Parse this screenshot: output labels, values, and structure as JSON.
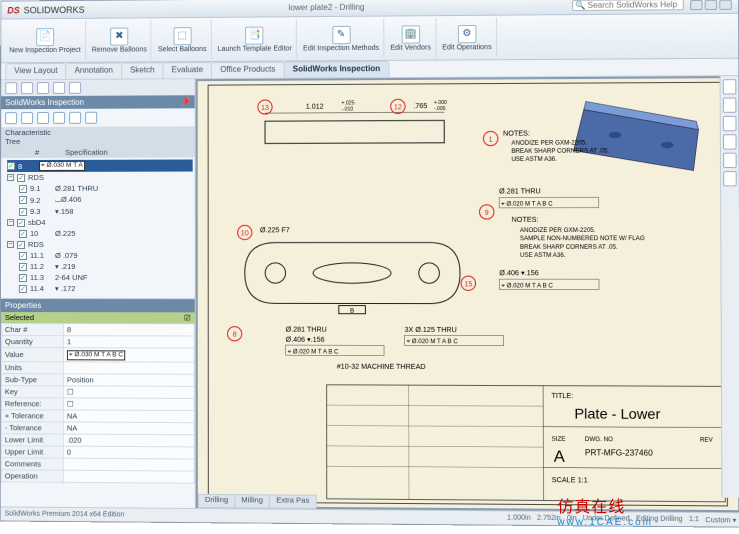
{
  "app": {
    "name": "SOLIDWORKS",
    "doc_title": "lower plate2 - Drilling",
    "search_placeholder": "Search SolidWorks Help"
  },
  "ribbon": [
    {
      "label": "New Inspection Project",
      "glyph": "📄"
    },
    {
      "label": "Remove Balloons",
      "glyph": "✖"
    },
    {
      "label": "Select Balloons",
      "glyph": "⬚"
    },
    {
      "label": "Launch Template Editor",
      "glyph": "📑"
    },
    {
      "label": "Edit Inspection Methods",
      "glyph": "✎"
    },
    {
      "label": "Edit Vendors",
      "glyph": "🏢"
    },
    {
      "label": "Edit Operations",
      "glyph": "⚙"
    }
  ],
  "tabs": [
    "View Layout",
    "Annotation",
    "Sketch",
    "Evaluate",
    "Office Products",
    "SolidWorks Inspection"
  ],
  "active_tab": "SolidWorks Inspection",
  "panel_title": "SolidWorks Inspection",
  "tree_header": {
    "col1": "#",
    "col2": "Specification"
  },
  "tree": [
    {
      "lvl": 0,
      "tog": "-",
      "chk": true,
      "num": "8",
      "spec": "⌖ Ø.030 M T A",
      "sel": true,
      "type": "gdt"
    },
    {
      "lvl": 0,
      "tog": "-",
      "chk": true,
      "num": "",
      "spec": "RDS",
      "type": "grp"
    },
    {
      "lvl": 1,
      "chk": true,
      "num": "9.1",
      "spec": "Ø.281 THRU"
    },
    {
      "lvl": 1,
      "chk": true,
      "num": "9.2",
      "spec": "⌴Ø.406"
    },
    {
      "lvl": 1,
      "chk": true,
      "num": "9.3",
      "spec": "▾.158"
    },
    {
      "lvl": 0,
      "tog": "-",
      "chk": true,
      "num": "",
      "spec": "sbD4",
      "type": "grp"
    },
    {
      "lvl": 1,
      "chk": true,
      "num": "10",
      "spec": "Ø.225"
    },
    {
      "lvl": 0,
      "tog": "-",
      "chk": true,
      "num": "",
      "spec": "RDS",
      "type": "grp"
    },
    {
      "lvl": 1,
      "chk": true,
      "num": "11.1",
      "spec": "Ø .079"
    },
    {
      "lvl": 1,
      "chk": true,
      "num": "11.2",
      "spec": "▾ .219"
    },
    {
      "lvl": 1,
      "chk": true,
      "num": "11.3",
      "spec": "2-64 UNF"
    },
    {
      "lvl": 1,
      "chk": true,
      "num": "11.4",
      "spec": "▾ .172"
    }
  ],
  "props": {
    "title": "Properties",
    "selected_label": "Selected",
    "rows": [
      {
        "k": "Char #",
        "v": "8"
      },
      {
        "k": "Quantity",
        "v": "1"
      },
      {
        "k": "Value",
        "v": "⌖ Ø.030 M T A B C"
      },
      {
        "k": "Units",
        "v": ""
      },
      {
        "k": "Sub-Type",
        "v": "Position"
      },
      {
        "k": "Key",
        "v": "☐"
      },
      {
        "k": "Reference:",
        "v": "☐"
      },
      {
        "k": "+ Tolerance",
        "v": "NA"
      },
      {
        "k": "- Tolerance",
        "v": "NA"
      },
      {
        "k": "Lower Limit",
        "v": ".020"
      },
      {
        "k": "Upper Limit",
        "v": "0"
      },
      {
        "k": "Comments",
        "v": ""
      },
      {
        "k": "Operation",
        "v": ""
      }
    ]
  },
  "drawing": {
    "dim_top_left": "1.012",
    "tol_top_left_u": "+.025",
    "tol_top_left_l": "-.010",
    "dim_top_right": ".765",
    "tol_top_right_u": "+.000",
    "tol_top_right_l": "-.005",
    "notes_title": "NOTES:",
    "notes": [
      "ANODIZE PER GXM-2205.",
      "BREAK SHARP CORNERS AT .05.",
      "USE ASTM A36."
    ],
    "notes2": [
      "ANODIZE PER GXM-2205.",
      "SAMPLE NON-NUMBERED NOTE W/ FLAG",
      "BREAK SHARP CORNERS AT .05.",
      "USE ASTM A36."
    ],
    "balloons": {
      "b1": "1",
      "b9": "9",
      "b10": "10",
      "b12": "12",
      "b13": "13",
      "b15": "15"
    },
    "dim_225": "Ø.225 F7",
    "dim_281": "Ø.281 THRU",
    "gdt_281": "⌖ Ø.020 M T A B C",
    "dim_406": "Ø.406 ▾.156",
    "gdt_406": "⌖ Ø.020 M T A B C",
    "dim_281b": "Ø.281 THRU",
    "dim_406b": "Ø.406 ▾.156",
    "dim_125": "3X Ø.125 THRU",
    "gdt_125": "⌖ Ø.020 M T A B C",
    "thread": "#10-32 MACHINE THREAD",
    "titleblock": {
      "title_label": "TITLE:",
      "title": "Plate - Lower",
      "size": "A",
      "dwg": "DWG. NO",
      "dwgno": "PRT-MFG-237460",
      "rev": "REV",
      "scale": "SCALE 1:1"
    }
  },
  "doctabs": [
    "Drilling",
    "Milling",
    "Extra Pas"
  ],
  "status": {
    "a": "1.000in",
    "b": "2.752in",
    "c": "0in",
    "d": "Under Defined",
    "e": "Editing Drilling",
    "f": "1:1",
    "g": "Custom ▾"
  },
  "footer": "SolidWorks Premium 2014 x64 Edition",
  "brand": {
    "cn": "仿真在线",
    "url": "www.1CAE.com"
  }
}
